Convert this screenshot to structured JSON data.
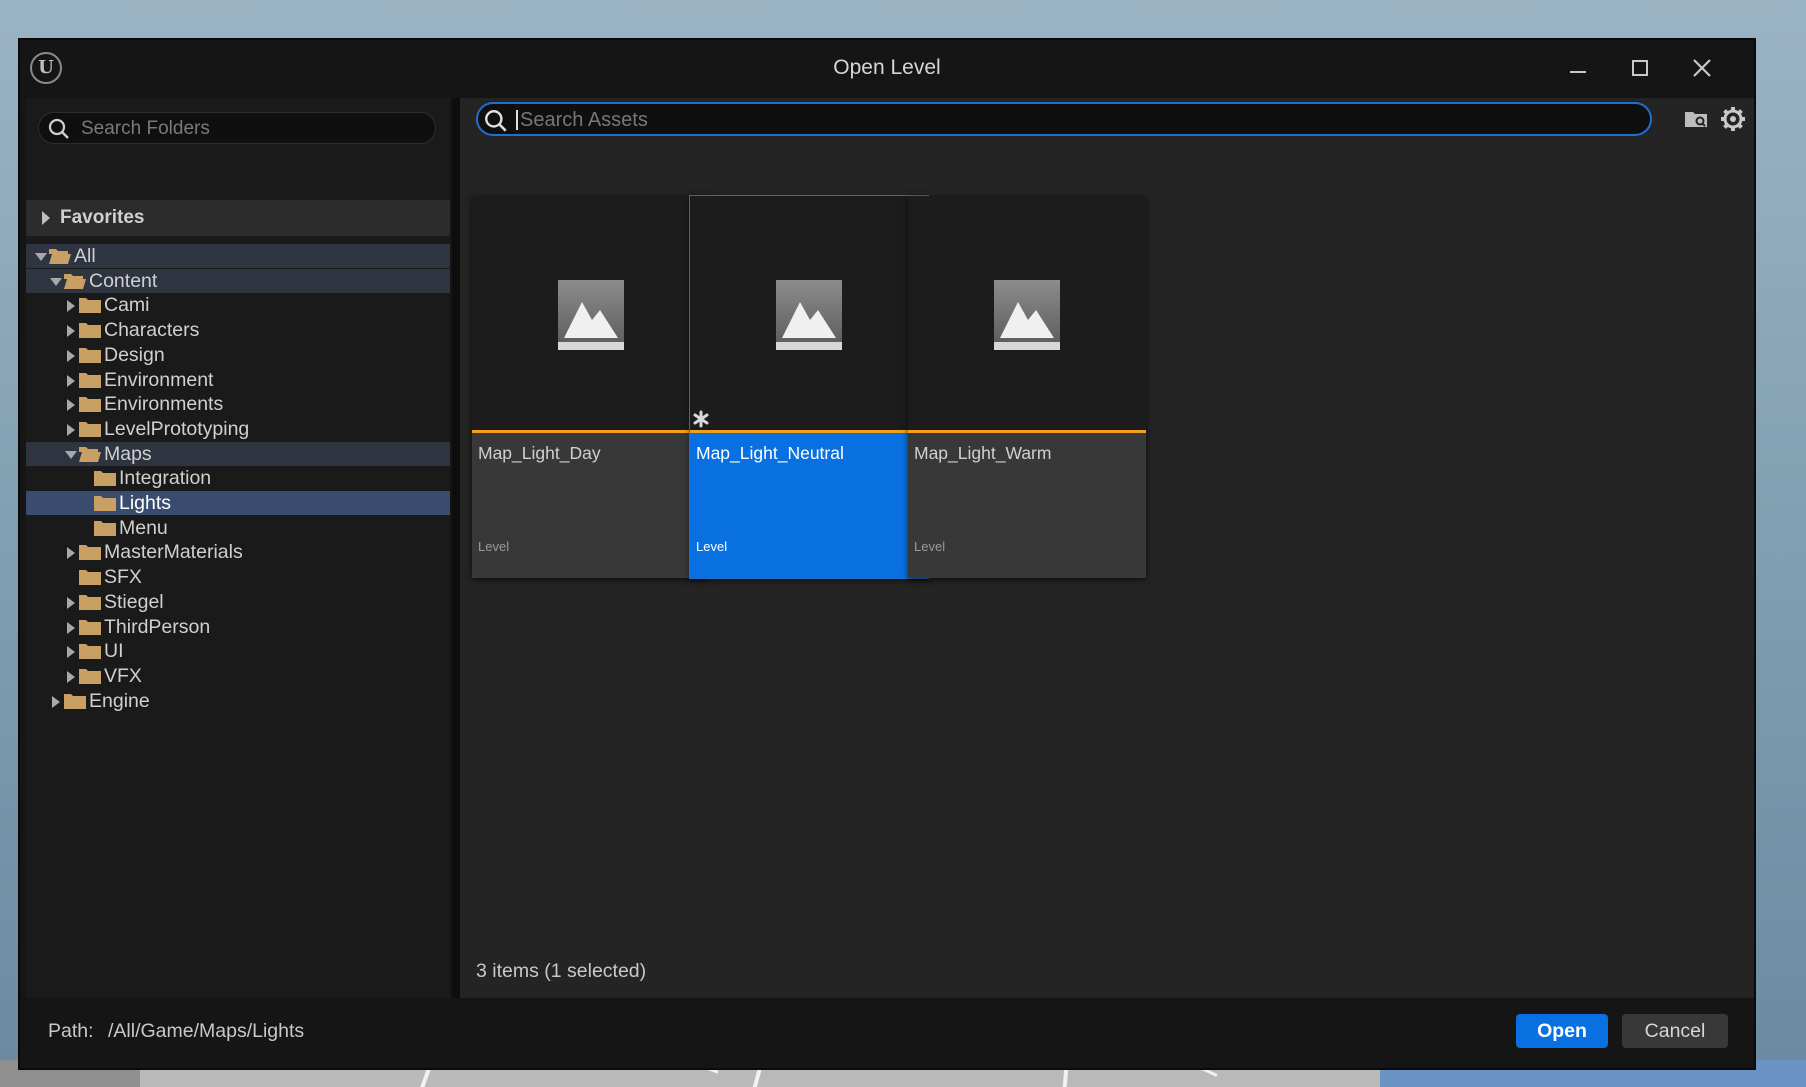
{
  "window": {
    "title": "Open Level",
    "logo_text": "U"
  },
  "folders": {
    "search_placeholder": "Search Folders",
    "favorites_label": "Favorites",
    "tree": [
      {
        "label": "All",
        "depth": 0,
        "expanded": true,
        "open_folder": true,
        "has_children": true
      },
      {
        "label": "Content",
        "depth": 1,
        "expanded": true,
        "open_folder": true,
        "has_children": true
      },
      {
        "label": "Cami",
        "depth": 2,
        "expanded": false,
        "has_children": true
      },
      {
        "label": "Characters",
        "depth": 2,
        "expanded": false,
        "has_children": true
      },
      {
        "label": "Design",
        "depth": 2,
        "expanded": false,
        "has_children": true
      },
      {
        "label": "Environment",
        "depth": 2,
        "expanded": false,
        "has_children": true
      },
      {
        "label": "Environments",
        "depth": 2,
        "expanded": false,
        "has_children": true
      },
      {
        "label": "LevelPrototyping",
        "depth": 2,
        "expanded": false,
        "has_children": true
      },
      {
        "label": "Maps",
        "depth": 2,
        "expanded": true,
        "open_folder": true,
        "has_children": true
      },
      {
        "label": "Integration",
        "depth": 3,
        "expanded": false,
        "has_children": false
      },
      {
        "label": "Lights",
        "depth": 3,
        "expanded": false,
        "has_children": false,
        "selected": true
      },
      {
        "label": "Menu",
        "depth": 3,
        "expanded": false,
        "has_children": false
      },
      {
        "label": "MasterMaterials",
        "depth": 2,
        "expanded": false,
        "has_children": true
      },
      {
        "label": "SFX",
        "depth": 2,
        "expanded": false,
        "has_children": false
      },
      {
        "label": "Stiegel",
        "depth": 2,
        "expanded": false,
        "has_children": true
      },
      {
        "label": "ThirdPerson",
        "depth": 2,
        "expanded": false,
        "has_children": true
      },
      {
        "label": "UI",
        "depth": 2,
        "expanded": false,
        "has_children": true
      },
      {
        "label": "VFX",
        "depth": 2,
        "expanded": false,
        "has_children": true
      },
      {
        "label": "Engine",
        "depth": 1,
        "expanded": false,
        "has_children": true
      }
    ]
  },
  "assets": {
    "search_placeholder": "Search Assets",
    "items": [
      {
        "name": "Map_Light_Day",
        "type": "Level",
        "selected": false
      },
      {
        "name": "Map_Light_Neutral",
        "type": "Level",
        "selected": true
      },
      {
        "name": "Map_Light_Warm",
        "type": "Level",
        "selected": false
      }
    ],
    "status": "3 items (1 selected)"
  },
  "footer": {
    "path_label": "Path:",
    "path_value": "/All/Game/Maps/Lights",
    "open_label": "Open",
    "cancel_label": "Cancel"
  },
  "colors": {
    "accent": "#0870e0",
    "type_bar": "#f3a018",
    "folder": "#c8a064"
  }
}
